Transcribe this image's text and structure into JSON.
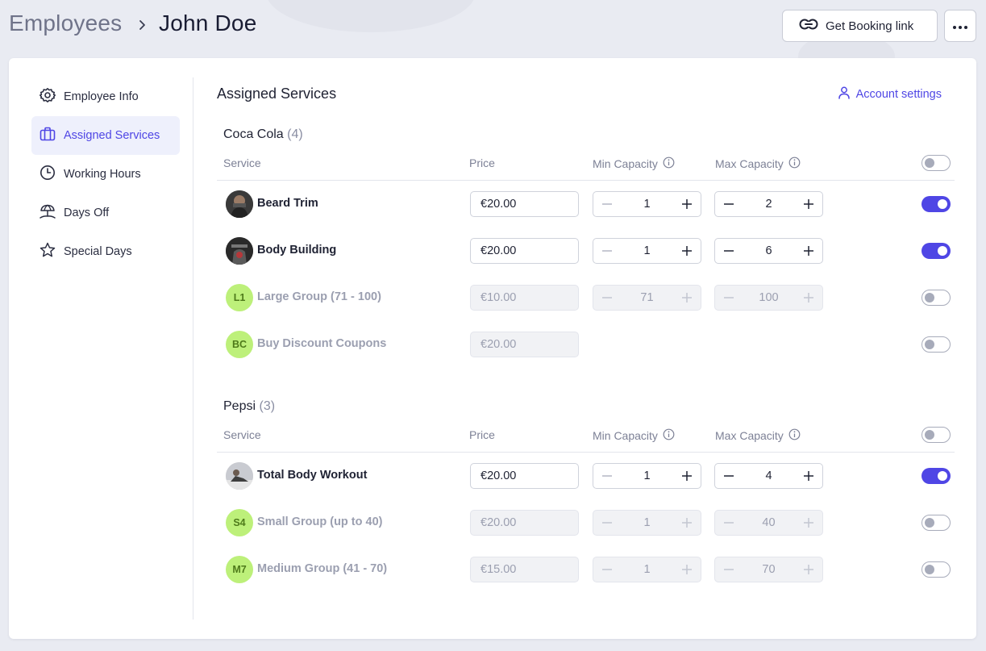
{
  "breadcrumb": {
    "root": "Employees",
    "current": "John Doe"
  },
  "header": {
    "booking_label": "Get Booking link"
  },
  "sidebar": {
    "items": [
      {
        "label": "Employee Info",
        "icon": "gear-icon",
        "active": false
      },
      {
        "label": "Assigned Services",
        "icon": "briefcase-icon",
        "active": true
      },
      {
        "label": "Working Hours",
        "icon": "clock-icon",
        "active": false
      },
      {
        "label": "Days Off",
        "icon": "beach-umbrella-icon",
        "active": false
      },
      {
        "label": "Special Days",
        "icon": "star-icon",
        "active": false
      }
    ]
  },
  "main": {
    "title": "Assigned Services",
    "account_link": "Account settings",
    "columns": {
      "service": "Service",
      "price": "Price",
      "min_capacity": "Min Capacity",
      "max_capacity": "Max Capacity"
    },
    "groups": [
      {
        "name": "Coca Cola",
        "count": "(4)",
        "services": [
          {
            "name": "Beard Trim",
            "avatar": "photo",
            "price": "€20.00",
            "min": "1",
            "max": "2",
            "enabled": true
          },
          {
            "name": "Body Building",
            "avatar": "photo",
            "price": "€20.00",
            "min": "1",
            "max": "6",
            "enabled": true
          },
          {
            "name": "Large Group (71 - 100)",
            "avatar": "initials",
            "initials": "L1",
            "price": "€10.00",
            "min": "71",
            "max": "100",
            "enabled": false
          },
          {
            "name": "Buy Discount Coupons",
            "avatar": "initials",
            "initials": "BC",
            "price": "€20.00",
            "min": null,
            "max": null,
            "enabled": false
          }
        ]
      },
      {
        "name": "Pepsi",
        "count": "(3)",
        "services": [
          {
            "name": "Total Body Workout",
            "avatar": "photo",
            "price": "€20.00",
            "min": "1",
            "max": "4",
            "enabled": true
          },
          {
            "name": "Small Group (up to 40)",
            "avatar": "initials",
            "initials": "S4",
            "price": "€20.00",
            "min": "1",
            "max": "40",
            "enabled": false
          },
          {
            "name": "Medium Group (41 - 70)",
            "avatar": "initials",
            "initials": "M7",
            "price": "€15.00",
            "min": "1",
            "max": "70",
            "enabled": false
          }
        ]
      }
    ]
  },
  "colors": {
    "accent": "#4f46e5",
    "active_bg": "#eef0fc",
    "avatar_initials_bg": "#bdf07a",
    "toggle_off": "#a7abba"
  }
}
